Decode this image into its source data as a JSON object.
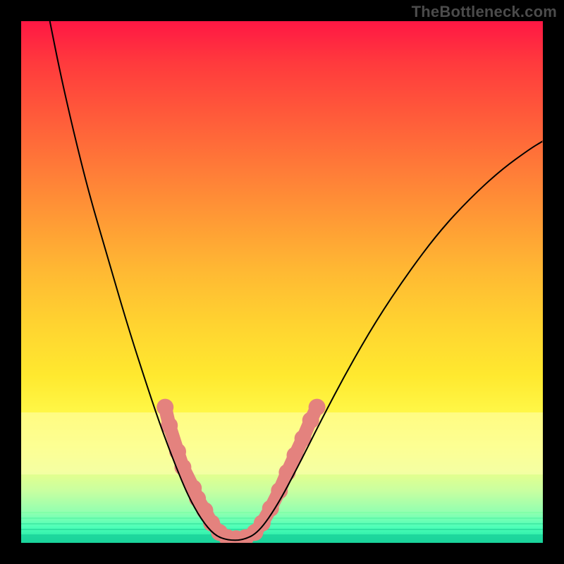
{
  "watermark": "TheBottleneck.com",
  "chart_data": {
    "type": "line",
    "title": "",
    "xlabel": "",
    "ylabel": "",
    "xlim": [
      0,
      1
    ],
    "ylim": [
      0,
      1
    ],
    "background_gradient_stops": [
      {
        "pos": 0.0,
        "color": "#ff1744"
      },
      {
        "pos": 0.08,
        "color": "#ff3a3d"
      },
      {
        "pos": 0.18,
        "color": "#ff5a3a"
      },
      {
        "pos": 0.28,
        "color": "#ff7a38"
      },
      {
        "pos": 0.38,
        "color": "#ff9a35"
      },
      {
        "pos": 0.48,
        "color": "#ffb933"
      },
      {
        "pos": 0.58,
        "color": "#ffd330"
      },
      {
        "pos": 0.68,
        "color": "#ffe92f"
      },
      {
        "pos": 0.76,
        "color": "#fff94a"
      },
      {
        "pos": 0.82,
        "color": "#f9ff6e"
      },
      {
        "pos": 0.86,
        "color": "#e9ff8a"
      },
      {
        "pos": 0.9,
        "color": "#c9ffa0"
      },
      {
        "pos": 0.94,
        "color": "#94ffb0"
      },
      {
        "pos": 0.97,
        "color": "#4dffb8"
      },
      {
        "pos": 1.0,
        "color": "#18e0a0"
      }
    ],
    "pale_band_y": [
      0.75,
      0.87
    ],
    "series": [
      {
        "name": "v-curve",
        "stroke": "#000000",
        "stroke_width": 2,
        "points": [
          {
            "x": 0.055,
            "y": 1.0
          },
          {
            "x": 0.075,
            "y": 0.9
          },
          {
            "x": 0.1,
            "y": 0.79
          },
          {
            "x": 0.13,
            "y": 0.67
          },
          {
            "x": 0.165,
            "y": 0.55
          },
          {
            "x": 0.2,
            "y": 0.43
          },
          {
            "x": 0.235,
            "y": 0.32
          },
          {
            "x": 0.265,
            "y": 0.23
          },
          {
            "x": 0.295,
            "y": 0.15
          },
          {
            "x": 0.32,
            "y": 0.09
          },
          {
            "x": 0.345,
            "y": 0.045
          },
          {
            "x": 0.37,
            "y": 0.015
          },
          {
            "x": 0.395,
            "y": 0.005
          },
          {
            "x": 0.425,
            "y": 0.005
          },
          {
            "x": 0.455,
            "y": 0.02
          },
          {
            "x": 0.49,
            "y": 0.07
          },
          {
            "x": 0.53,
            "y": 0.145
          },
          {
            "x": 0.575,
            "y": 0.235
          },
          {
            "x": 0.625,
            "y": 0.33
          },
          {
            "x": 0.68,
            "y": 0.425
          },
          {
            "x": 0.74,
            "y": 0.515
          },
          {
            "x": 0.8,
            "y": 0.595
          },
          {
            "x": 0.86,
            "y": 0.66
          },
          {
            "x": 0.92,
            "y": 0.715
          },
          {
            "x": 0.975,
            "y": 0.755
          },
          {
            "x": 1.0,
            "y": 0.77
          }
        ]
      },
      {
        "name": "salmon-markers",
        "stroke": "#e4827e",
        "marker_radius": 12,
        "points": [
          {
            "x": 0.276,
            "y": 0.26
          },
          {
            "x": 0.284,
            "y": 0.225
          },
          {
            "x": 0.3,
            "y": 0.175
          },
          {
            "x": 0.31,
            "y": 0.145
          },
          {
            "x": 0.33,
            "y": 0.105
          },
          {
            "x": 0.338,
            "y": 0.085
          },
          {
            "x": 0.352,
            "y": 0.062
          },
          {
            "x": 0.365,
            "y": 0.038
          },
          {
            "x": 0.38,
            "y": 0.02
          },
          {
            "x": 0.395,
            "y": 0.01
          },
          {
            "x": 0.412,
            "y": 0.008
          },
          {
            "x": 0.43,
            "y": 0.01
          },
          {
            "x": 0.448,
            "y": 0.02
          },
          {
            "x": 0.462,
            "y": 0.038
          },
          {
            "x": 0.478,
            "y": 0.066
          },
          {
            "x": 0.495,
            "y": 0.1
          },
          {
            "x": 0.51,
            "y": 0.135
          },
          {
            "x": 0.525,
            "y": 0.168
          },
          {
            "x": 0.54,
            "y": 0.2
          },
          {
            "x": 0.555,
            "y": 0.235
          },
          {
            "x": 0.567,
            "y": 0.26
          }
        ]
      }
    ]
  }
}
